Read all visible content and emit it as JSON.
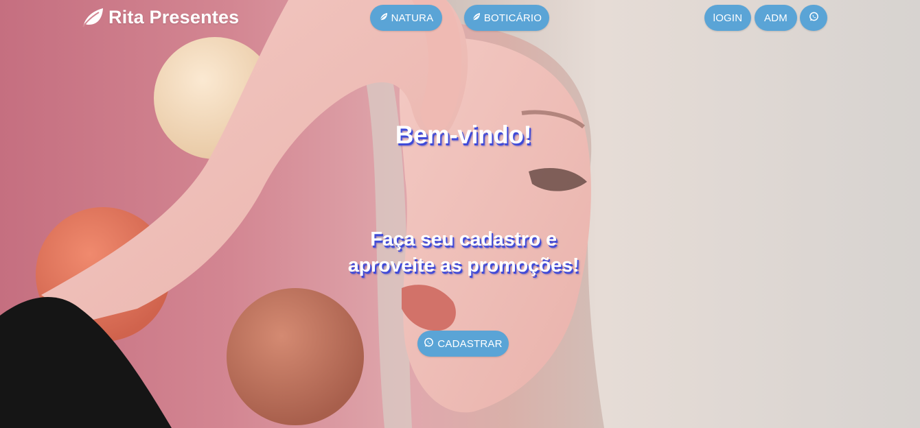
{
  "brand": {
    "name": "Rita Presentes",
    "icon": "leaf-icon"
  },
  "nav": {
    "natura": "NATURA",
    "boticario": "BOTICÁRIO",
    "login": "lOGIN",
    "adm": "ADM",
    "whatsapp_icon": "whatsapp-icon"
  },
  "hero": {
    "headline": "Bem-vindo!",
    "subline_1": "Faça seu cadastro e",
    "subline_2": "aproveite as promoções!",
    "cta_label": "CADASTRAR"
  },
  "colors": {
    "button": "#5aa4d6",
    "text_shadow": "#3f4ad8",
    "background": "#d38692"
  }
}
